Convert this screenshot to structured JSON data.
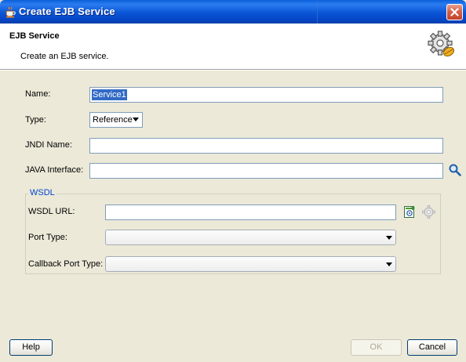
{
  "window": {
    "title": "Create EJB Service"
  },
  "header": {
    "title": "EJB Service",
    "subtitle": "Create an EJB service."
  },
  "form": {
    "name": {
      "label": "Name:",
      "value": "Service1"
    },
    "type": {
      "label": "Type:",
      "value": "Reference"
    },
    "jndi": {
      "label": "JNDI Name:",
      "value": ""
    },
    "java_interface": {
      "label": "JAVA Interface:",
      "value": ""
    }
  },
  "wsdl": {
    "legend": "WSDL",
    "url": {
      "label": "WSDL URL:",
      "value": ""
    },
    "port_type": {
      "label": "Port Type:",
      "value": ""
    },
    "callback_port_type": {
      "label": "Callback Port Type:",
      "value": ""
    }
  },
  "buttons": {
    "help": "Help",
    "ok": "OK",
    "cancel": "Cancel"
  },
  "colors": {
    "titlebar": "#0A55D6",
    "selection": "#316AC5",
    "group_legend": "#0046D5",
    "close_button": "#D86048"
  },
  "icons": {
    "app": "coffee-cup-icon",
    "close": "close-icon",
    "header": "gear-wizard-icon",
    "browse": "search-icon",
    "wsdl_add": "wsdl-generate-icon",
    "wsdl_settings": "gear-icon"
  }
}
